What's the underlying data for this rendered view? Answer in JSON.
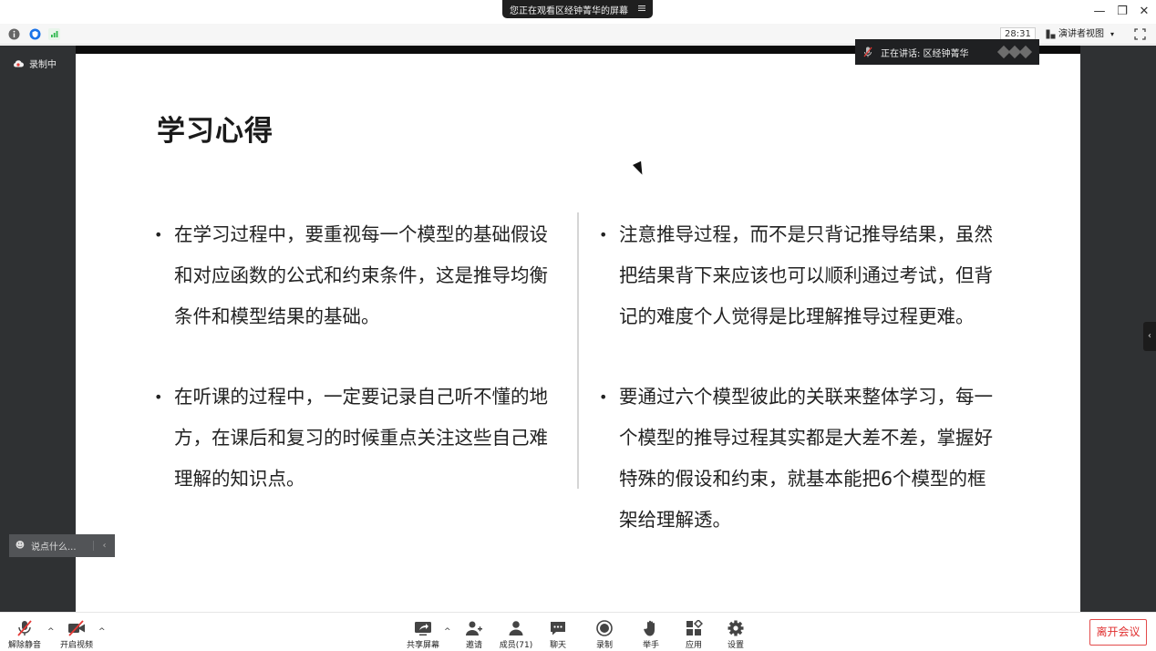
{
  "window": {
    "share_banner": "您正在观看区经钟菁华的屏幕",
    "controls": {
      "minimize": "—",
      "restore": "❐",
      "close": "✕"
    }
  },
  "status": {
    "timer": "28:31",
    "view_mode": "演讲者视图",
    "view_mode_caret": "▾"
  },
  "stage": {
    "recording_label": "录制中",
    "speaker_label": "正在讲话: 区经钟菁华",
    "chat_placeholder": "说点什么...",
    "chat_collapse": "‹",
    "side_collapse": "‹"
  },
  "slide": {
    "title": "学习心得",
    "bullets": [
      "在学习过程中，要重视每一个模型的基础假设和对应函数的公式和约束条件，这是推导均衡条件和模型结果的基础。",
      "在听课的过程中，一定要记录自己听不懂的地方，在课后和复习的时候重点关注这些自己难理解的知识点。",
      "注意推导过程，而不是只背记推导结果，虽然把结果背下来应该也可以顺利通过考试，但背记的难度个人觉得是比理解推导过程更难。",
      "要通过六个模型彼此的关联来整体学习，每一个模型的推导过程其实都是大差不差，掌握好特殊的假设和约束，就基本能把6个模型的框架给理解透。"
    ]
  },
  "toolbar": {
    "unmute": "解除静音",
    "start_video": "开启视频",
    "share_screen": "共享屏幕",
    "invite": "邀请",
    "members": "成员(71)",
    "chat": "聊天",
    "record": "录制",
    "raise_hand": "举手",
    "apps": "应用",
    "settings": "设置",
    "leave": "离开会议",
    "caret": "^"
  },
  "colors": {
    "stage_bg": "#2f3133",
    "leave_red": "#e02f2f",
    "muted_red": "#e53935",
    "shield_blue": "#1a73e8",
    "signal_green": "#2db84d"
  }
}
